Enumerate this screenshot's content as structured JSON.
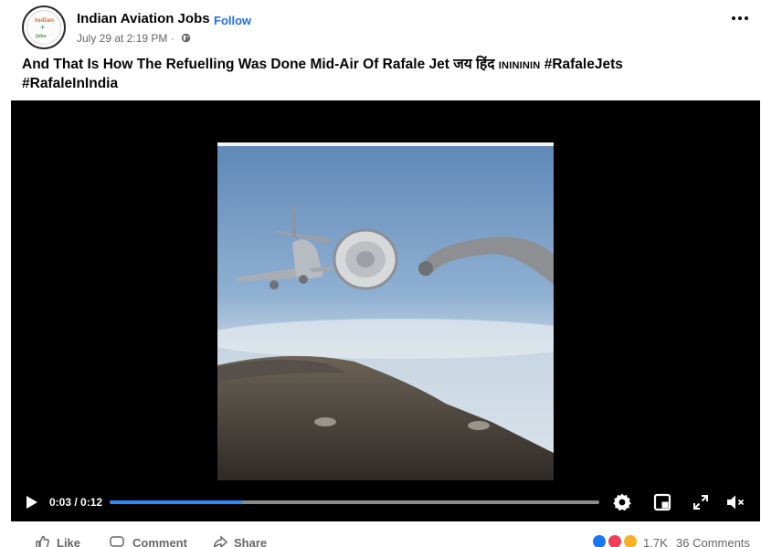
{
  "post": {
    "page_name": "Indian Aviation Jobs",
    "separator": "·",
    "follow_label": "Follow",
    "timestamp": "July 29 at 2:19 PM",
    "meta_separator": "·",
    "privacy_icon": "globe-icon",
    "more_icon": "more-horizontal-icon",
    "avatar_text": {
      "line1": "Indian",
      "line2": "✈",
      "line3": "Jobs"
    }
  },
  "caption": {
    "text": "And That Is How The Refuelling Was Done Mid-Air Of Rafale Jet जय हिंद ",
    "flags": "ININININ",
    "hashtag1": " #RafaleJets",
    "hashtag2": "#RafaleInIndia"
  },
  "video": {
    "play_icon": "play-icon",
    "time": "0:03 / 0:12",
    "progress": 0.27,
    "settings_icon": "gear-icon",
    "pip_icon": "picture-in-picture-icon",
    "fullscreen_icon": "fullscreen-icon",
    "mute_icon": "speaker-muted-icon",
    "accent_color": "#2d88ff"
  },
  "footer": {
    "like_label": "Like",
    "comment_label": "Comment",
    "share_label": "Share",
    "reaction_count": "1.7K",
    "comment_count": "36 Comments",
    "reactions": [
      "like-reaction-icon",
      "love-reaction-icon",
      "wow-reaction-icon"
    ]
  }
}
